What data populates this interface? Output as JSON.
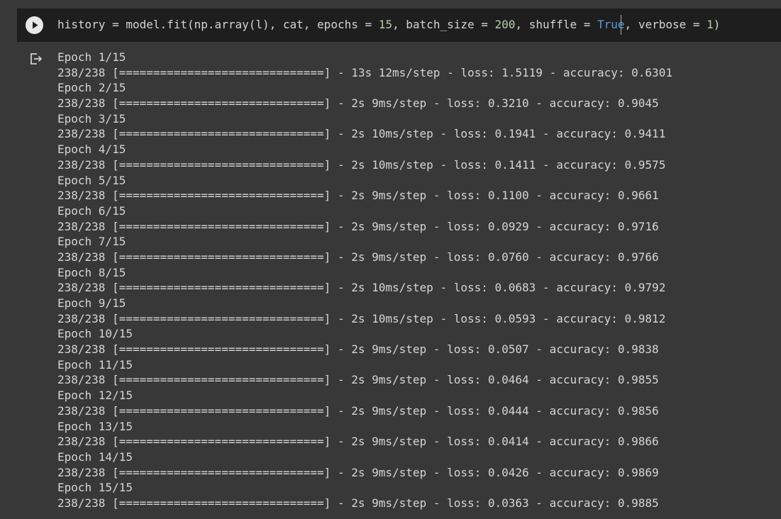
{
  "cell": {
    "code": {
      "p1": "history = model.fit(np.array(l), cat, epochs = ",
      "epochs": "15",
      "p2": ", batch_size = ",
      "batch_size": "200",
      "p3": ", shuffle = ",
      "shuffle": "True",
      "p4": ", verbose = ",
      "verbose": "1",
      "p5": ")"
    }
  },
  "output": {
    "epochs": [
      {
        "header": "Epoch 1/15",
        "progress": "238/238 [==============================] - 13s 12ms/step - loss: 1.5119 - accuracy: 0.6301"
      },
      {
        "header": "Epoch 2/15",
        "progress": "238/238 [==============================] - 2s 9ms/step - loss: 0.3210 - accuracy: 0.9045"
      },
      {
        "header": "Epoch 3/15",
        "progress": "238/238 [==============================] - 2s 10ms/step - loss: 0.1941 - accuracy: 0.9411"
      },
      {
        "header": "Epoch 4/15",
        "progress": "238/238 [==============================] - 2s 10ms/step - loss: 0.1411 - accuracy: 0.9575"
      },
      {
        "header": "Epoch 5/15",
        "progress": "238/238 [==============================] - 2s 9ms/step - loss: 0.1100 - accuracy: 0.9661"
      },
      {
        "header": "Epoch 6/15",
        "progress": "238/238 [==============================] - 2s 9ms/step - loss: 0.0929 - accuracy: 0.9716"
      },
      {
        "header": "Epoch 7/15",
        "progress": "238/238 [==============================] - 2s 9ms/step - loss: 0.0760 - accuracy: 0.9766"
      },
      {
        "header": "Epoch 8/15",
        "progress": "238/238 [==============================] - 2s 10ms/step - loss: 0.0683 - accuracy: 0.9792"
      },
      {
        "header": "Epoch 9/15",
        "progress": "238/238 [==============================] - 2s 10ms/step - loss: 0.0593 - accuracy: 0.9812"
      },
      {
        "header": "Epoch 10/15",
        "progress": "238/238 [==============================] - 2s 9ms/step - loss: 0.0507 - accuracy: 0.9838"
      },
      {
        "header": "Epoch 11/15",
        "progress": "238/238 [==============================] - 2s 9ms/step - loss: 0.0464 - accuracy: 0.9855"
      },
      {
        "header": "Epoch 12/15",
        "progress": "238/238 [==============================] - 2s 9ms/step - loss: 0.0444 - accuracy: 0.9856"
      },
      {
        "header": "Epoch 13/15",
        "progress": "238/238 [==============================] - 2s 9ms/step - loss: 0.0414 - accuracy: 0.9866"
      },
      {
        "header": "Epoch 14/15",
        "progress": "238/238 [==============================] - 2s 9ms/step - loss: 0.0426 - accuracy: 0.9869"
      },
      {
        "header": "Epoch 15/15",
        "progress": "238/238 [==============================] - 2s 9ms/step - loss: 0.0363 - accuracy: 0.9885"
      }
    ]
  },
  "icons": {
    "run": "play-circle-icon",
    "output": "output-redirect-icon"
  }
}
